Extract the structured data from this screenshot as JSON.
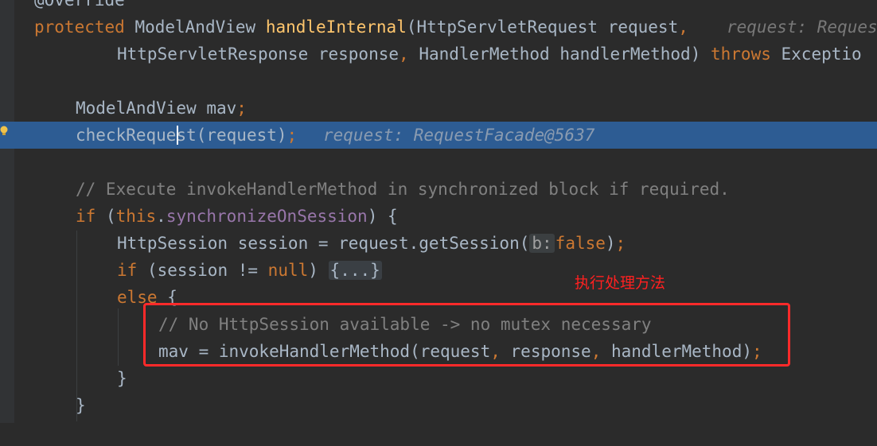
{
  "editor": {
    "lines": {
      "l0_annotation": "@Override",
      "l1_kw_protected": "protected",
      "l1_type": "ModelAndView",
      "l1_fn": "handleInternal",
      "l1_params": "(HttpServletRequest request",
      "l1_comma": ",",
      "l1_hint": "request: Reques",
      "l2_params": "HttpServletResponse response",
      "l2_comma": ",",
      "l2_params2": "HandlerMethod handlerMethod)",
      "l2_kw_throws": "throws",
      "l2_exception": "Exceptio",
      "l4_decl": "ModelAndView mav",
      "l4_semi": ";",
      "l5_call_a": "checkReque",
      "l5_call_b": "st(request)",
      "l5_semi": ";",
      "l5_hint": "request: RequestFacade@5637",
      "l7_comment": "// Execute invokeHandlerMethod in synchronized block if required.",
      "l8_kw_if": "if",
      "l8_paren": " (",
      "l8_this": "this",
      "l8_dot": ".",
      "l8_field": "synchronizeOnSession",
      "l8_rest": ") {",
      "l9_decl": "HttpSession session = request.getSession(",
      "l9_param_hint": "b:",
      "l9_false": "false",
      "l9_close": ")",
      "l9_semi": ";",
      "l10_kw_if": "if",
      "l10_cond": " (session != ",
      "l10_null": "null",
      "l10_paren": ") ",
      "l10_fold": "{...}",
      "l11_kw_else": "else",
      "l11_brace": " {",
      "l12_comment": "// No HttpSession available -> no mutex necessary",
      "l13_assign": "mav = invokeHandlerMethod(request",
      "l13_comma1": ",",
      "l13_mid": " response",
      "l13_comma2": ",",
      "l13_end": " handlerMethod)",
      "l13_semi": ";",
      "l14_brace": "}",
      "l15_brace": "}"
    }
  },
  "annotation": {
    "text": "执行处理方法",
    "color": "#ff2020"
  },
  "colors": {
    "background": "#2b2b2b",
    "keyword": "#cc7832",
    "function": "#ffc66d",
    "comment": "#808080",
    "field": "#9876aa",
    "highlight": "#2d5c93",
    "box": "#ff2a2a"
  },
  "icons": {
    "breakpoint_bulb": "lightbulb-icon"
  }
}
